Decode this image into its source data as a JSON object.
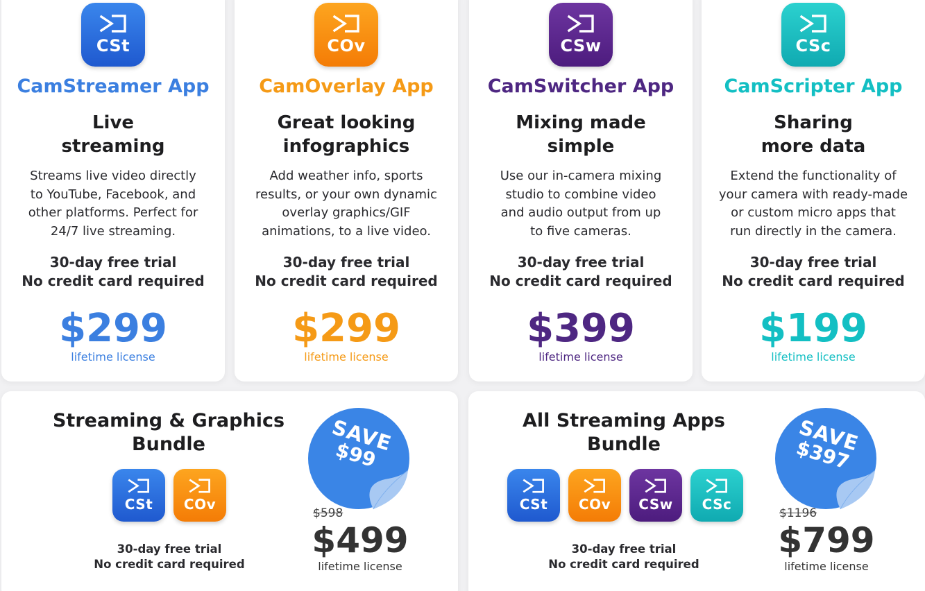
{
  "apps": [
    {
      "abbr": "CSt",
      "name": "CamStreamer App",
      "tagline": [
        "Live",
        "streaming"
      ],
      "desc": [
        "Streams live video directly",
        "to YouTube, Facebook, and",
        "other platforms. Perfect for",
        "24/7 live streaming."
      ],
      "trial": [
        "30-day free trial",
        "No credit card required"
      ],
      "price": "$299",
      "license": "lifetime license",
      "color": "#3b7fe0"
    },
    {
      "abbr": "COv",
      "name": "CamOverlay App",
      "tagline": [
        "Great looking",
        "infographics"
      ],
      "desc": [
        "Add weather info, sports",
        "results, or your own dynamic",
        "overlay graphics/GIF",
        "animations, to a live video."
      ],
      "trial": [
        "30-day free trial",
        "No credit card required"
      ],
      "price": "$299",
      "license": "lifetime license",
      "color": "#f59a16"
    },
    {
      "abbr": "CSw",
      "name": "CamSwitcher App",
      "tagline": [
        "Mixing made",
        "simple"
      ],
      "desc": [
        "Use our in-camera mixing",
        "studio to combine video",
        "and audio output from up",
        "to five cameras."
      ],
      "trial": [
        "30-day free trial",
        "No credit card required"
      ],
      "price": "$399",
      "license": "lifetime license",
      "color": "#4e2782"
    },
    {
      "abbr": "CSc",
      "name": "CamScripter App",
      "tagline": [
        "Sharing",
        "more data"
      ],
      "desc": [
        "Extend the functionality of",
        "your camera with ready-made",
        "or custom micro apps that",
        "run directly in the camera."
      ],
      "trial": [
        "30-day free trial",
        "No credit card required"
      ],
      "price": "$199",
      "license": "lifetime license",
      "color": "#13bfc3"
    }
  ],
  "bundles": [
    {
      "title": [
        "Streaming & Graphics",
        "Bundle"
      ],
      "logos": [
        "CSt",
        "COv"
      ],
      "save_label": "SAVE",
      "save_amount": "$99",
      "old_price": "$598",
      "price": "$499",
      "license": "lifetime license",
      "trial": [
        "30-day free trial",
        "No credit card required"
      ]
    },
    {
      "title": [
        "All Streaming Apps",
        "Bundle"
      ],
      "logos": [
        "CSt",
        "COv",
        "CSw",
        "CSc"
      ],
      "save_label": "SAVE",
      "save_amount": "$397",
      "old_price": "$1196",
      "price": "$799",
      "license": "lifetime license",
      "trial": [
        "30-day free trial",
        "No credit card required"
      ]
    }
  ],
  "icons": {
    "logo": "camstreamer-arrow-frame-icon",
    "sticker": "peeling-sticker-icon"
  },
  "colors": {
    "blue": "#3b7fe0",
    "orange": "#f59a16",
    "purple": "#4e2782",
    "teal": "#13bfc3",
    "sticker": "#3a85e6"
  }
}
